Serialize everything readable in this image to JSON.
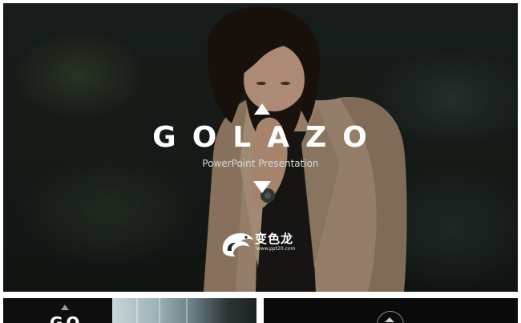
{
  "hero": {
    "title": "GOLAZO",
    "subtitle": "PowerPoint Presentation",
    "watermark": {
      "name": "变色龙",
      "url": "www.ppt20.com"
    }
  },
  "thumbnails": [
    {
      "text": "GO"
    },
    {
      "text": ""
    }
  ],
  "colors": {
    "background_dark": "#1a201c",
    "title_text": "#ffffff",
    "subtitle_text": "#d8d8d8",
    "jacket": "#b69a80",
    "page_background": "#ffffff"
  },
  "icons": [
    "triangle-up-icon",
    "triangle-down-icon",
    "chameleon-logo-icon"
  ]
}
